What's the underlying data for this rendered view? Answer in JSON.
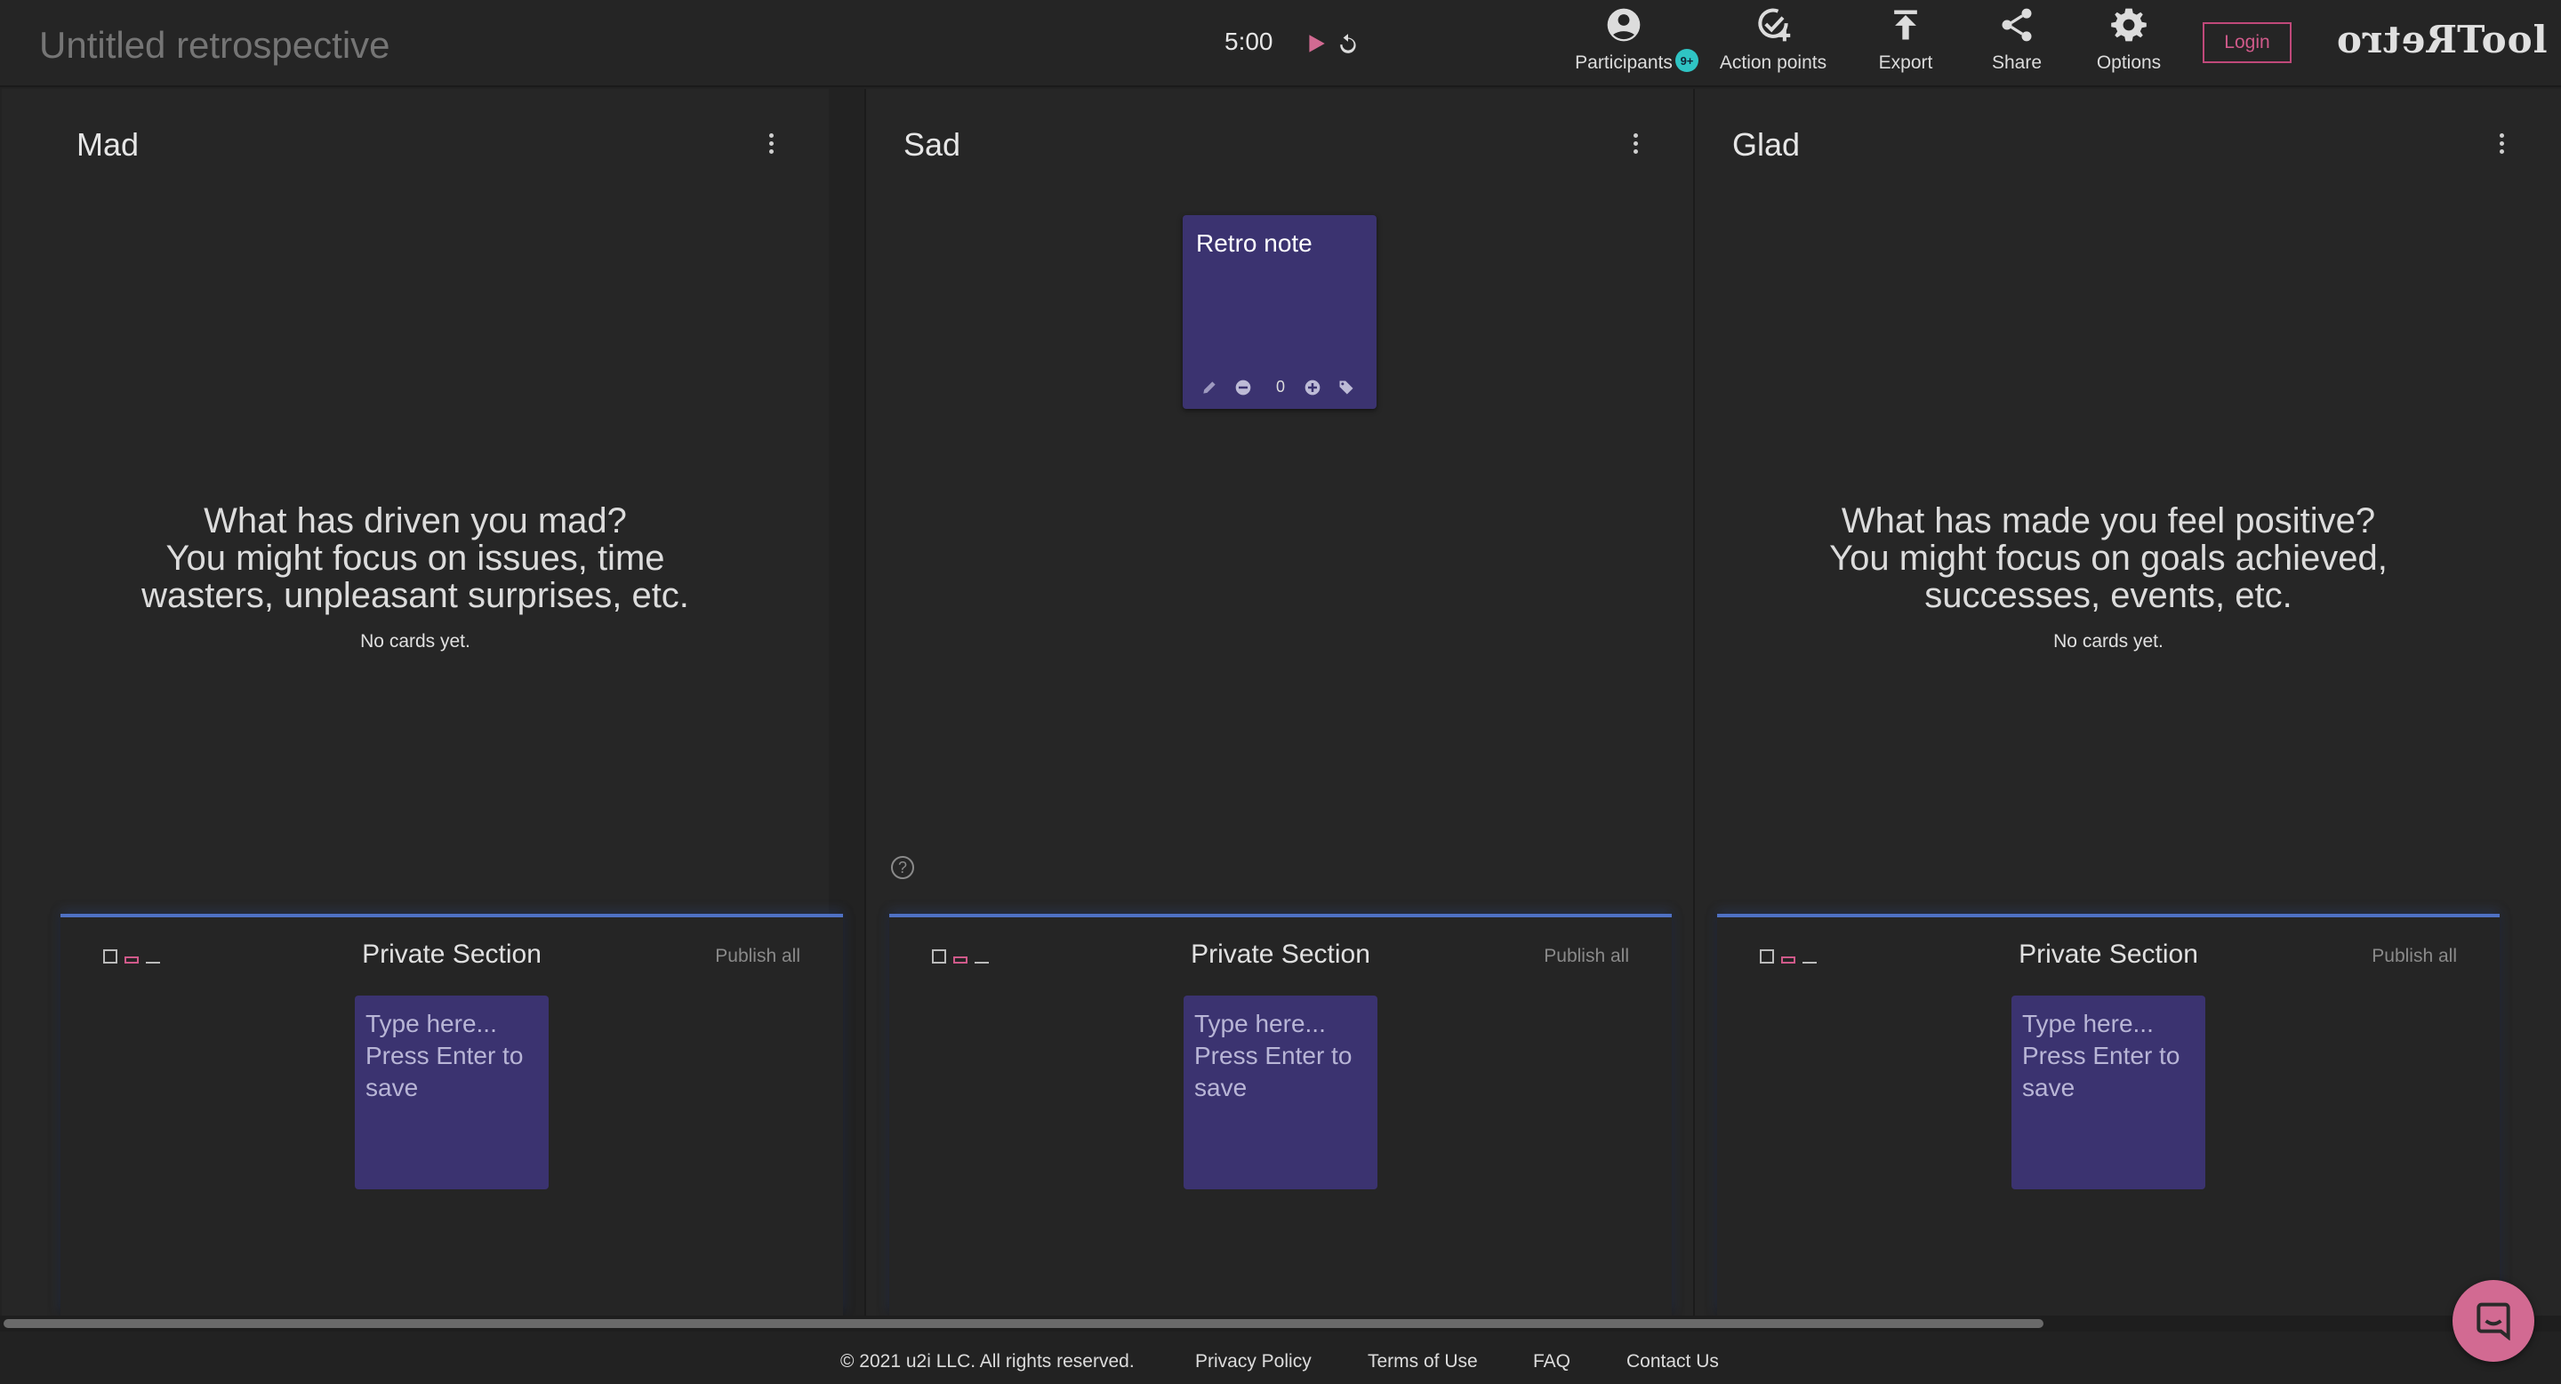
{
  "header": {
    "title_placeholder": "Untitled retrospective",
    "timer": "5:00",
    "nav": [
      {
        "label": "Participants",
        "icon": "account-circle-icon"
      },
      {
        "label": "Action points",
        "icon": "check-circle-plus-icon"
      },
      {
        "label": "Export",
        "icon": "upload-icon"
      },
      {
        "label": "Share",
        "icon": "share-icon"
      },
      {
        "label": "Options",
        "icon": "gear-icon"
      }
    ],
    "participants_badge": "9+",
    "login_label": "Login",
    "logo_mirrored": "Retro",
    "logo_suffix": "Tool"
  },
  "columns": [
    {
      "title": "Mad",
      "prompt_lines": [
        "What has driven you mad?",
        "You might focus on issues, time",
        "wasters, unpleasant surprises, etc."
      ],
      "empty_text": "No cards yet."
    },
    {
      "title": "Sad",
      "notes": [
        {
          "text": "Retro note",
          "votes": "0"
        }
      ]
    },
    {
      "title": "Glad",
      "prompt_lines": [
        "What has made you feel positive?",
        "You might focus on goals achieved,",
        "successes, events, etc."
      ],
      "empty_text": "No cards yet."
    }
  ],
  "private_section": {
    "title": "Private Section",
    "publish_label": "Publish all",
    "draft_placeholder": "Type here...\nPress Enter to save"
  },
  "footer": {
    "copyright": "© 2021  u2i LLC. All rights reserved.",
    "links": [
      "Privacy Policy",
      "Terms of Use",
      "FAQ",
      "Contact Us"
    ]
  },
  "colors": {
    "background": "#222222",
    "note": "#3b3370",
    "accent_pink": "#d26a92",
    "private_border": "#4f71c4",
    "badge": "#2fc4c4"
  }
}
